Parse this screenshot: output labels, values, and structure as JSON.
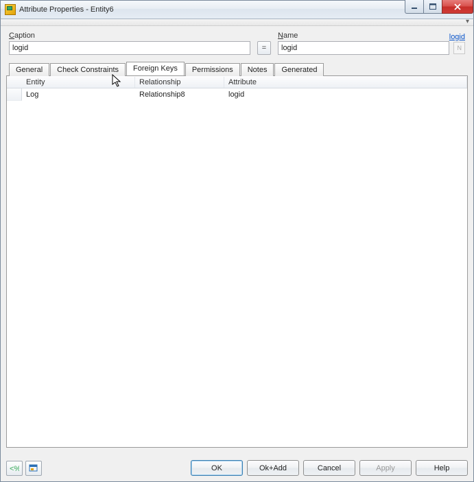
{
  "window": {
    "title": "Attribute Properties - Entity6"
  },
  "fields": {
    "caption_label_pre": "",
    "caption_underline": "C",
    "caption_label_post": "aption",
    "caption_value": "logid",
    "eq_label": "=",
    "name_underline": "N",
    "name_label_post": "ame",
    "name_value": "logid",
    "name_link": "logid",
    "nn_label": "N"
  },
  "tabs": {
    "items": [
      {
        "label": "General"
      },
      {
        "label": "Check Constraints"
      },
      {
        "label": "Foreign Keys"
      },
      {
        "label": "Permissions"
      },
      {
        "label": "Notes"
      },
      {
        "label": "Generated"
      }
    ],
    "active_index": 2
  },
  "grid": {
    "columns": {
      "entity": "Entity",
      "relationship": "Relationship",
      "attribute": "Attribute"
    },
    "rows": [
      {
        "entity": "Log",
        "relationship": "Relationship8",
        "attribute": "logid"
      }
    ]
  },
  "buttons": {
    "ok": "OK",
    "ok_add": "Ok+Add",
    "cancel": "Cancel",
    "apply": "Apply",
    "help": "Help"
  }
}
